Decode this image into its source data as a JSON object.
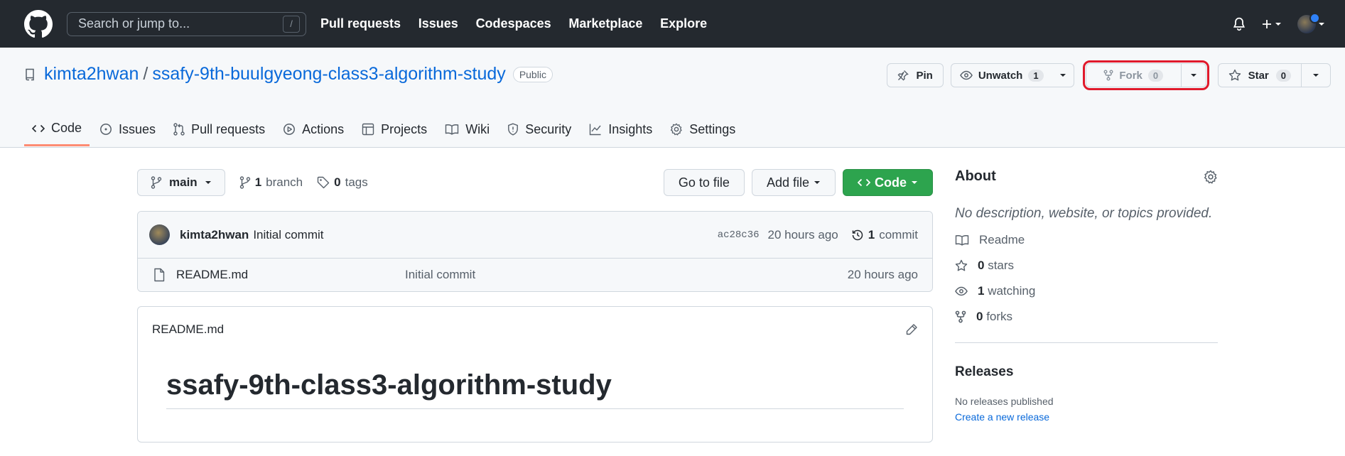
{
  "header": {
    "search_placeholder": "Search or jump to...",
    "search_key": "/",
    "nav": [
      "Pull requests",
      "Issues",
      "Codespaces",
      "Marketplace",
      "Explore"
    ]
  },
  "repo": {
    "owner": "kimta2hwan",
    "separator": "/",
    "name": "ssafy-9th-buulgyeong-class3-algorithm-study",
    "visibility": "Public",
    "actions": {
      "pin": "Pin",
      "unwatch": "Unwatch",
      "watch_count": "1",
      "fork": "Fork",
      "fork_count": "0",
      "star": "Star",
      "star_count": "0"
    },
    "tabs": [
      "Code",
      "Issues",
      "Pull requests",
      "Actions",
      "Projects",
      "Wiki",
      "Security",
      "Insights",
      "Settings"
    ]
  },
  "files": {
    "branch": "main",
    "branch_count": "1",
    "branch_label": "branch",
    "tag_count": "0",
    "tag_label": "tags",
    "go_to_file": "Go to file",
    "add_file": "Add file",
    "code_button": "Code",
    "latest_commit": {
      "author": "kimta2hwan",
      "message": "Initial commit",
      "sha": "ac28c36",
      "age": "20 hours ago",
      "commit_count": "1",
      "commit_label": "commit"
    },
    "rows": [
      {
        "name": "README.md",
        "message": "Initial commit",
        "age": "20 hours ago"
      }
    ]
  },
  "readme": {
    "filename": "README.md",
    "heading": "ssafy-9th-class3-algorithm-study"
  },
  "about": {
    "title": "About",
    "description": "No description, website, or topics provided.",
    "readme": "Readme",
    "stars_count": "0",
    "stars_label": "stars",
    "watching_count": "1",
    "watching_label": "watching",
    "forks_count": "0",
    "forks_label": "forks"
  },
  "releases": {
    "title": "Releases",
    "none": "No releases published",
    "create_link": "Create a new release"
  },
  "colors": {
    "header_bg": "#24292f",
    "link": "#0969da",
    "code_button": "#2da44e",
    "active_tab_underline": "#fd8c73",
    "highlight": "#e0192b"
  }
}
